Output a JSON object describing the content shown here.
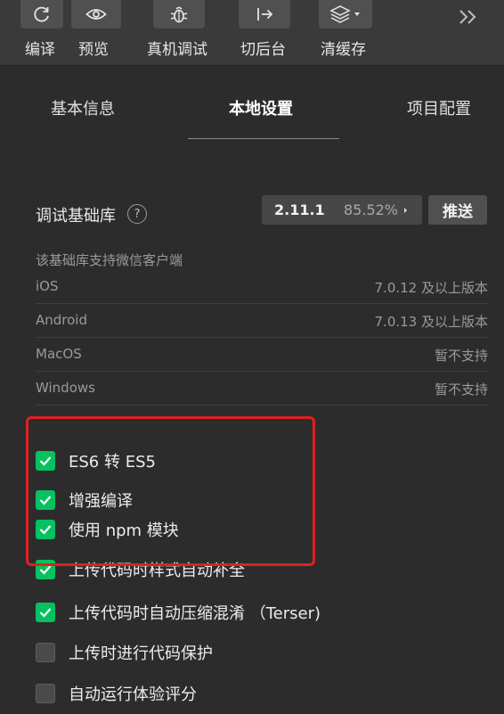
{
  "toolbar": {
    "buttons": [
      {
        "label": "编译",
        "icon": "refresh-icon"
      },
      {
        "label": "预览",
        "icon": "eye-icon"
      },
      {
        "label": "真机调试",
        "icon": "bug-icon"
      },
      {
        "label": "切后台",
        "icon": "switch-background-icon"
      },
      {
        "label": "清缓存",
        "icon": "layers-icon"
      }
    ],
    "more_icon": "double-chevron-right-icon"
  },
  "tabs": [
    {
      "label": "基本信息",
      "active": false
    },
    {
      "label": "本地设置",
      "active": true
    },
    {
      "label": "项目配置",
      "active": false
    }
  ],
  "library": {
    "title": "调试基础库",
    "version": "2.11.1",
    "percent": "85.52%",
    "push_label": "推送",
    "help_symbol": "?"
  },
  "support": {
    "caption": "该基础库支持微信客户端",
    "rows": [
      {
        "platform": "iOS",
        "value": "7.0.12 及以上版本"
      },
      {
        "platform": "Android",
        "value": "7.0.13 及以上版本"
      },
      {
        "platform": "MacOS",
        "value": "暂不支持"
      },
      {
        "platform": "Windows",
        "value": "暂不支持"
      }
    ]
  },
  "options": [
    {
      "label": "ES6 转 ES5",
      "checked": true
    },
    {
      "label": "增强编译",
      "checked": true
    },
    {
      "label": "使用 npm 模块",
      "checked": true
    },
    {
      "label": "上传代码时样式自动补全",
      "checked": true
    },
    {
      "label": "上传代码时自动压缩混淆 （Terser)",
      "checked": true
    },
    {
      "label": "上传时进行代码保护",
      "checked": false
    },
    {
      "label": "自动运行体验评分",
      "checked": false
    }
  ],
  "colors": {
    "background": "#2c2c2c",
    "toolbar": "#3a3a3a",
    "checkbox_on": "#07c160",
    "highlight": "#e02020"
  }
}
